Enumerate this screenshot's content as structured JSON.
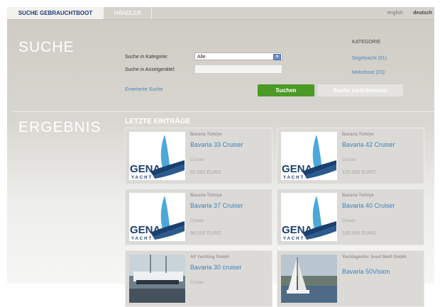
{
  "nav": {
    "tabs": [
      {
        "label": "SUCHE GEBRAUCHTBOOT"
      },
      {
        "label": "HÄNDLER"
      }
    ],
    "languages": [
      "english",
      "deutsch"
    ]
  },
  "search": {
    "title": "SUCHE",
    "category_label": "Suche in Kategorie:",
    "category_value": "Alle",
    "title_label": "Suche in Anzeigentitel:",
    "title_value": "",
    "advanced_link": "Erweiterte Suche",
    "submit_label": "Suchen",
    "reset_label": "Suche zurücksetzen"
  },
  "categories": {
    "heading": "KATEGORIE",
    "items": [
      {
        "label": "Segelyacht (51)"
      },
      {
        "label": "Motorboot (23)"
      }
    ]
  },
  "results": {
    "title": "ERGEBNIS",
    "section_heading": "LETZTE EINTRÄGE",
    "items": [
      {
        "dealer": "Bavaria Türkiye",
        "model": "Bavaria 33 Cruiser",
        "type": "Cruiser",
        "price": "82.550 EURO",
        "image": "gena-yacht-logo"
      },
      {
        "dealer": "Bavaria Türkiye",
        "model": "Bavaria 42 Cruiser",
        "type": "Cruiser",
        "price": "120.000 EURO",
        "image": "gena-yacht-logo"
      },
      {
        "dealer": "Bavaria Türkiye",
        "model": "Bavaria 37 Cruiser",
        "type": "Cruiser",
        "price": "90.000 EURO",
        "image": "gena-yacht-logo"
      },
      {
        "dealer": "Bavaria Türkiye",
        "model": "Bavaria 40 Cruiser",
        "type": "Cruiser",
        "price": "100.000 EURO",
        "image": "gena-yacht-logo"
      },
      {
        "dealer": "AP Yachting GmbH",
        "model": "Bavaria 30 cruiser",
        "type": "Cruiser",
        "price": "",
        "image": "marina-photo"
      },
      {
        "dealer": "Yachtagentur Josef Meltl GmbH",
        "model": "Bavaria 50Vision",
        "type": "",
        "price": "",
        "image": "sailboat-photo"
      }
    ]
  },
  "logo": {
    "text_top": "GENA",
    "text_bottom": "YACHT"
  },
  "colors": {
    "accent_blue": "#3d84be",
    "search_green": "#4a9a25",
    "nav_active_text": "#1f3c72",
    "logo_navy": "#1b3f6e",
    "logo_sky": "#4ba8d8"
  }
}
